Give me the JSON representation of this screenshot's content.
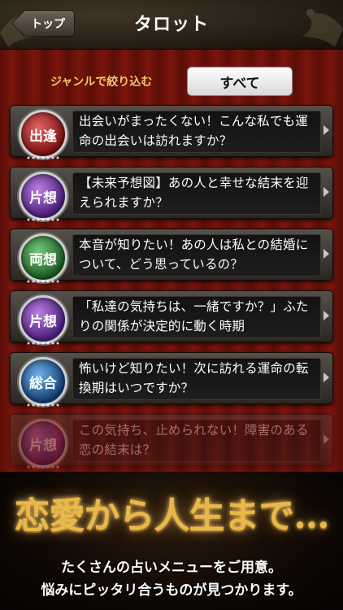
{
  "header": {
    "back_label": "トップ",
    "title": "タロット"
  },
  "filter": {
    "label": "ジャンルで絞り込む",
    "button_label": "すべて"
  },
  "cards": [
    {
      "badge": "出逢",
      "badge_color": "#9b1c1c",
      "text": "出会いがまったくない！こんな私でも運命の出会いは訪れますか？"
    },
    {
      "badge": "片想",
      "badge_color": "#5a2a8a",
      "text": "【未来予想図】あの人と幸せな結末を迎えられますか？"
    },
    {
      "badge": "両想",
      "badge_color": "#2a6a2e",
      "text": "本音が知りたい！あの人は私との結婚について、どう思っているの？"
    },
    {
      "badge": "片想",
      "badge_color": "#5a2a8a",
      "text": "「私達の気持ちは、一緒ですか？」ふたりの関係が決定的に動く時期"
    },
    {
      "badge": "総合",
      "badge_color": "#1c4a80",
      "text": "怖いけど知りたい！次に訪れる運命の転換期はいつですか？"
    },
    {
      "badge": "片想",
      "badge_color": "#5a2a8a",
      "text": "この気持ち、止められない！障害のある恋の結末は？"
    }
  ],
  "promo": {
    "headline": "恋愛から人生まで…",
    "line1": "たくさんの占いメニューをご用意。",
    "line2": "悩みにピッタリ合うものが見つかります。"
  }
}
